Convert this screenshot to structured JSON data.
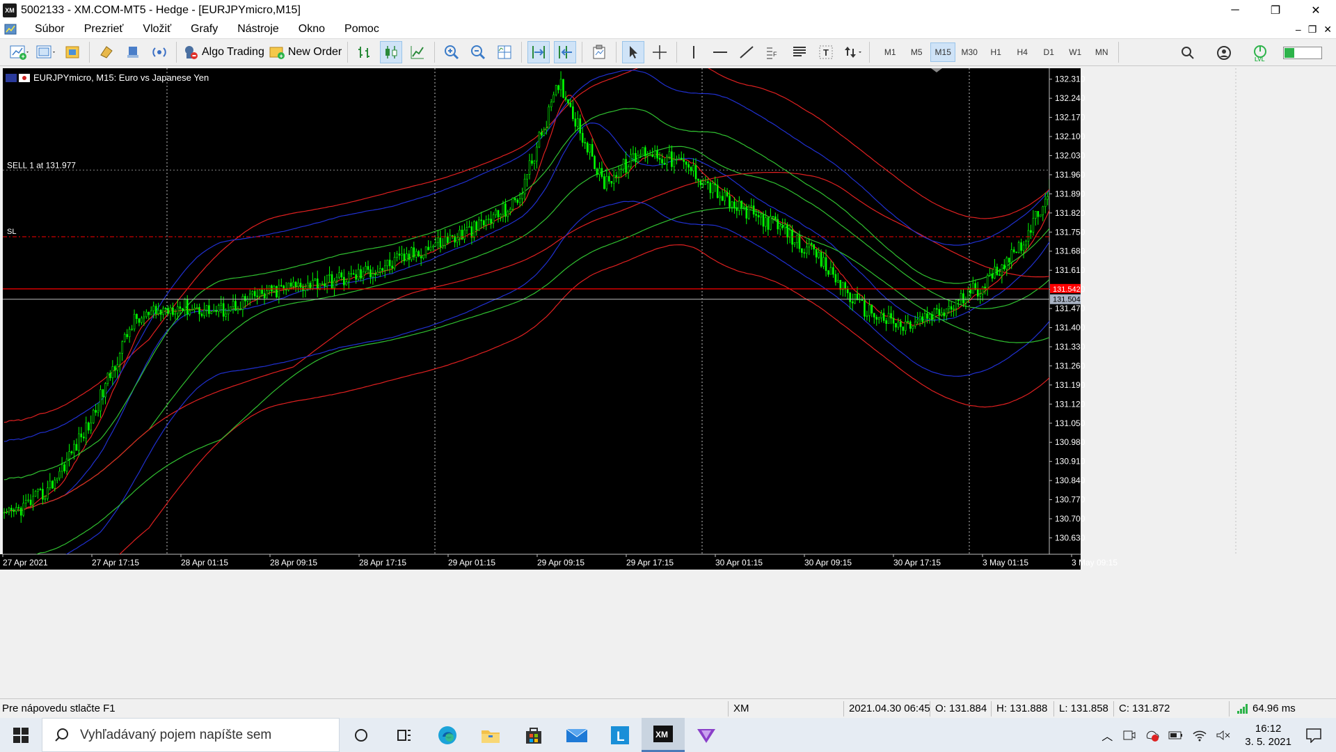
{
  "window": {
    "title": "5002133 - XM.COM-MT5 - Hedge - [EURJPYmicro,M15]",
    "app_icon_text": "XM",
    "controls": [
      "─",
      "❐",
      "✕"
    ]
  },
  "menu": {
    "items": [
      "Súbor",
      "Prezrieť",
      "Vložiť",
      "Grafy",
      "Nástroje",
      "Okno",
      "Pomoc"
    ],
    "mdi_controls": [
      "–",
      "❐",
      "✕"
    ]
  },
  "toolbar": {
    "algo_trading_label": "Algo Trading",
    "new_order_label": "New Order",
    "timeframes": [
      "M1",
      "M5",
      "M15",
      "M30",
      "H1",
      "H4",
      "D1",
      "W1",
      "MN"
    ],
    "active_timeframe": "M15"
  },
  "chart": {
    "header": "EURJPYmicro, M15:  Euro vs Japanese Yen",
    "sell_label": "SELL 1 at 131.977",
    "sl_label": "SL",
    "bid_label": "131.504",
    "ask_label": "131.542",
    "price_ticks": [
      "132.310",
      "132.240",
      "132.170",
      "132.100",
      "132.030",
      "131.960",
      "131.890",
      "131.820",
      "131.750",
      "131.680",
      "131.610",
      "131.540",
      "131.470",
      "131.400",
      "131.330",
      "131.260",
      "131.190",
      "131.120",
      "131.050",
      "130.980",
      "130.910",
      "130.840",
      "130.770",
      "130.700",
      "130.630"
    ],
    "time_ticks": [
      "27 Apr 2021",
      "27 Apr 17:15",
      "28 Apr 01:15",
      "28 Apr 09:15",
      "28 Apr 17:15",
      "29 Apr 01:15",
      "29 Apr 09:15",
      "29 Apr 17:15",
      "30 Apr 01:15",
      "30 Apr 09:15",
      "30 Apr 17:15",
      "3 May 01:15",
      "3 May 09:15"
    ],
    "colors": {
      "background": "#000000",
      "bars": "#00ff00",
      "grid": "#c0c0c0",
      "sell_line": "#ff0000",
      "bid_line": "#c0c0c0",
      "band_red": "#e02020",
      "band_blue": "#2030d0",
      "band_green": "#30c030"
    }
  },
  "chart_data": {
    "type": "line",
    "title": "EURJPYmicro, M15:  Euro vs Japanese Yen",
    "x_categories": [
      "27 Apr 2021",
      "27 Apr 17:15",
      "28 Apr 01:15",
      "28 Apr 09:15",
      "28 Apr 17:15",
      "29 Apr 01:15",
      "29 Apr 09:15",
      "29 Apr 17:15",
      "30 Apr 01:15",
      "30 Apr 09:15",
      "30 Apr 17:15",
      "3 May 01:15",
      "3 May 09:15"
    ],
    "ylim": [
      130.57,
      132.35
    ],
    "close_series": [
      130.7,
      130.8,
      131.05,
      131.42,
      131.48,
      131.46,
      131.52,
      131.56,
      131.58,
      131.63,
      131.7,
      131.76,
      131.86,
      132.3,
      131.93,
      132.05,
      131.99,
      131.85,
      131.78,
      131.66,
      131.48,
      131.4,
      131.46,
      131.57,
      131.75,
      132.12,
      131.93,
      131.5
    ],
    "orders": [
      {
        "label": "SELL 1 at 131.977",
        "price": 131.977
      }
    ],
    "sl_price": 131.733,
    "bid": 131.504,
    "ask": 131.542
  },
  "status": {
    "help": "Pre nápovedu stlačte F1",
    "profile": "XM",
    "datetime": "2021.04.30 06:45",
    "open": "O: 131.884",
    "high": "H: 131.888",
    "low": "L: 131.858",
    "close": "C: 131.872",
    "ping": "64.96 ms"
  },
  "taskbar": {
    "search_placeholder": "Vyhľadávaný pojem napíšte sem",
    "time": "16:12",
    "date": "3. 5. 2021"
  }
}
